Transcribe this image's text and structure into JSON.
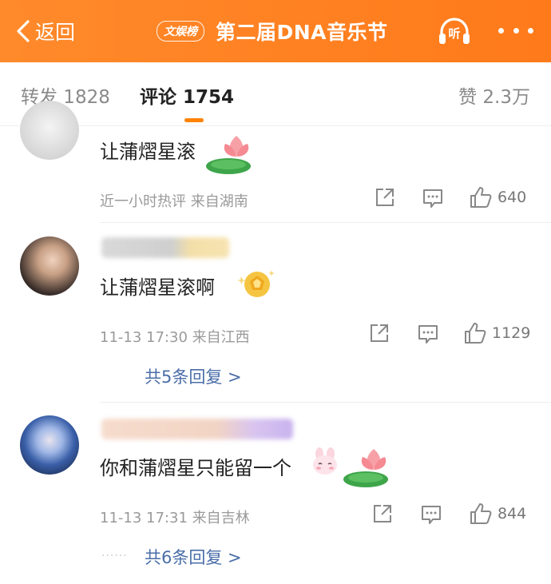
{
  "header": {
    "back_label": "返回",
    "badge": "文娱榜",
    "title": "第二届DNA音乐节",
    "listen_label": "听",
    "accent_color": "#ff7a1a"
  },
  "tabs": {
    "repost": "转发 1828",
    "comment": "评论 1754",
    "like": "赞 2.3万",
    "indicator_color": "#ff8200"
  },
  "comments": [
    {
      "text": "让蒲熠星滚",
      "meta": "近一小时热评  来自湖南",
      "like_count": "640",
      "sticker": "lotus-sticker"
    },
    {
      "text": "让蒲熠星滚啊",
      "meta": "11-13 17:30  来自江西",
      "like_count": "1129",
      "replies": "共5条回复 >",
      "sticker": "gold-medal-sticker"
    },
    {
      "text": "你和蒲熠星只能留一个",
      "meta": "11-13 17:31  来自吉林",
      "like_count": "844",
      "replies": "共6条回复 >",
      "sticker": "lotus-sticker"
    }
  ],
  "icons": {
    "back": "chevron-left-icon",
    "listen": "headphones-icon",
    "more": "more-dots-icon",
    "share": "share-icon",
    "comment": "comment-icon",
    "like": "thumbs-up-icon"
  },
  "reply_link_color": "#4a6ea8"
}
